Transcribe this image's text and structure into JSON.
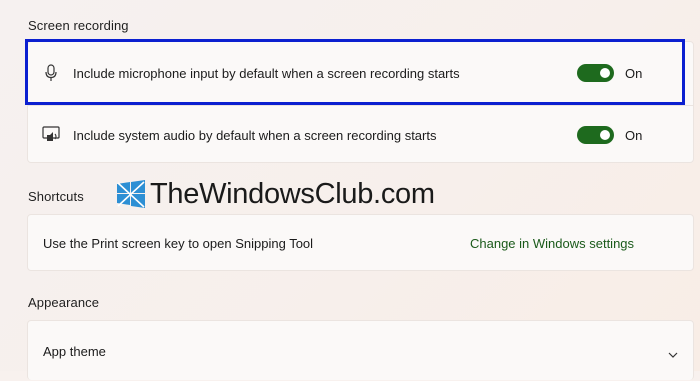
{
  "screen_recording": {
    "header": "Screen recording",
    "microphone": {
      "icon": "microphone-icon",
      "label": "Include microphone input by default when a screen recording starts",
      "state": "On",
      "on": true
    },
    "system_audio": {
      "icon": "speaker-icon",
      "label": "Include system audio by default when a screen recording starts",
      "state": "On",
      "on": true
    }
  },
  "shortcuts": {
    "header": "Shortcuts",
    "print_screen": {
      "label": "Use the Print screen key to open Snipping Tool",
      "link": "Change in Windows settings"
    }
  },
  "appearance": {
    "header": "Appearance",
    "app_theme": {
      "label": "App theme",
      "icon": "chevron-down-icon"
    }
  },
  "watermark": {
    "text": "TheWindowsClub.com",
    "logo": "thewindowsclub-logo"
  },
  "colors": {
    "toggle_on": "#1e6a1e",
    "highlight": "#0b1fd0",
    "link": "#1a5a1a"
  }
}
